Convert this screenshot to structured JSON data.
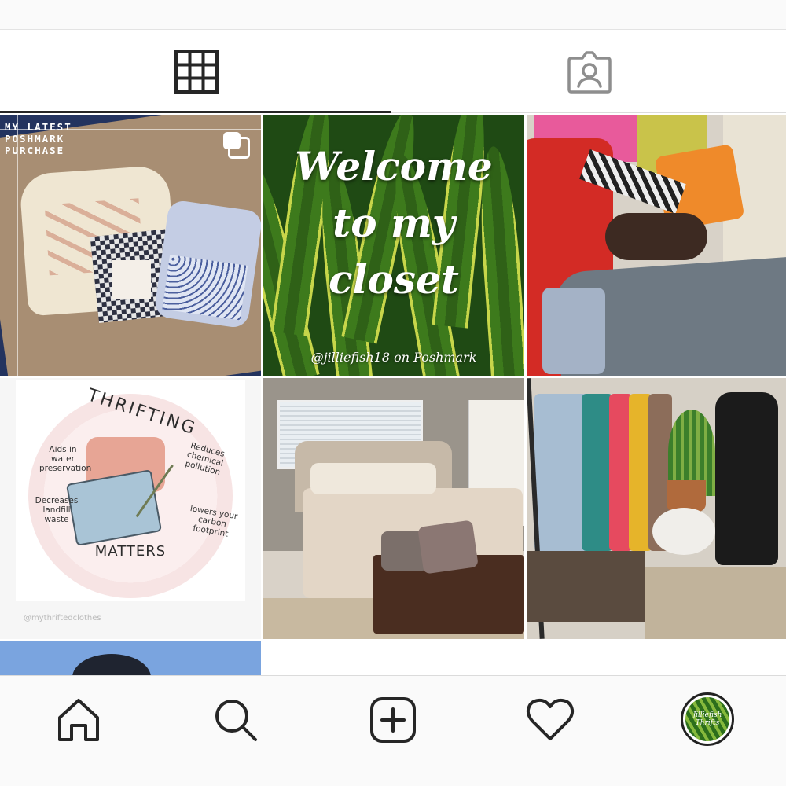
{
  "tabs": [
    {
      "name": "posts-grid",
      "icon": "grid-icon",
      "active": true
    },
    {
      "name": "tagged",
      "icon": "tagged-user-icon",
      "active": false
    }
  ],
  "posts": [
    {
      "caption": "MY LATEST\nPOSHMARK\nPURCHASE",
      "multi": true
    },
    {
      "script": "Welcome\nto my\ncloset",
      "handle": "@jilliefish18 on Poshmark"
    },
    {},
    {
      "title": "THRIFTING",
      "notes": [
        "Aids in water preservation",
        "Reduces chemical pollution",
        "Decreases landfill waste",
        "lowers your carbon footprint"
      ],
      "footer": "MATTERS",
      "watermark": "@mythriftedclothes"
    },
    {},
    {},
    {}
  ],
  "nav": {
    "items": [
      "home-icon",
      "search-icon",
      "add-post-icon",
      "heart-icon",
      "profile-avatar"
    ],
    "avatar_text": "Jilliefish Thrifts"
  },
  "colors": {
    "active_tab": "#262626",
    "icon": "#262626",
    "inactive_icon": "#8e8e8e"
  }
}
